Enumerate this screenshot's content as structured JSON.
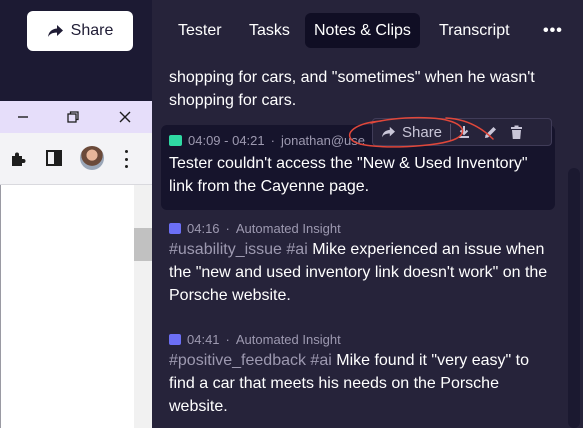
{
  "header": {
    "share_label": "Share"
  },
  "browser": {
    "minimize_symbol": "—",
    "close_symbol": "✕"
  },
  "tabs": [
    {
      "label": "Tester"
    },
    {
      "label": "Tasks"
    },
    {
      "label": "Notes & Clips",
      "active": true
    },
    {
      "label": "Transcript"
    },
    {
      "label": "•••"
    }
  ],
  "previous_note": {
    "line1": "shopping for cars, and \"sometimes\" when he wasn't",
    "line2": "shopping for cars."
  },
  "clip": {
    "time_range": "04:09 - 04:21",
    "separator": "·",
    "author": "jonathan@use",
    "text": "Tester couldn't access the \"New & Used Inventory\" link from the Cayenne page.",
    "icon": "clip-icon",
    "accent_color": "#2fd9a3"
  },
  "clip_toolbar": {
    "share_label": "Share",
    "icons": [
      "download-icon",
      "edit-icon",
      "trash-icon"
    ]
  },
  "insights": [
    {
      "time": "04:16",
      "separator": "·",
      "source": "Automated Insight",
      "tags": "#usability_issue #ai",
      "text": "Mike experienced an issue when the \"new and used inventory link doesn't work\" on the Porsche website."
    },
    {
      "time": "04:41",
      "separator": "·",
      "source": "Automated Insight",
      "tags": "#positive_feedback #ai",
      "text": "Mike found it \"very easy\" to find a car that meets his needs on the Porsche website."
    }
  ],
  "colors": {
    "panel_bg": "#26233a",
    "active_tab_bg": "#100e24",
    "card_bg": "#16142c",
    "insight_icon": "#6c6ff5",
    "annotation_red": "#e0473a"
  }
}
